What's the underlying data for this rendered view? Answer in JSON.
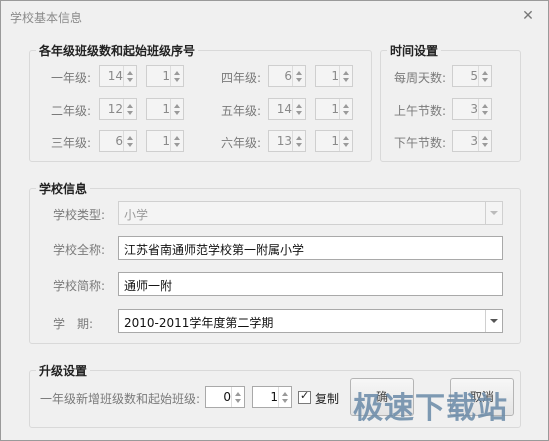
{
  "window": {
    "title": "学校基本信息"
  },
  "classes": {
    "title": "各年级班级数和起始班级序号",
    "rows": [
      {
        "label": "一年级:",
        "count": "14",
        "start": "1"
      },
      {
        "label": "二年级:",
        "count": "12",
        "start": "1"
      },
      {
        "label": "三年级:",
        "count": "6",
        "start": "1"
      },
      {
        "label": "四年级:",
        "count": "6",
        "start": "1"
      },
      {
        "label": "五年级:",
        "count": "14",
        "start": "1"
      },
      {
        "label": "六年级:",
        "count": "13",
        "start": "1"
      }
    ]
  },
  "time": {
    "title": "时间设置",
    "rows": [
      {
        "label": "每周天数:",
        "value": "5"
      },
      {
        "label": "上午节数:",
        "value": "3"
      },
      {
        "label": "下午节数:",
        "value": "3"
      }
    ]
  },
  "school": {
    "title": "学校信息",
    "type_label": "学校类型:",
    "type_value": "小学",
    "fullname_label": "学校全称:",
    "fullname_value": "江苏省南通师范学校第一附属小学",
    "shortname_label": "学校简称:",
    "shortname_value": "通师一附",
    "term_label": "学　期:",
    "term_value": "2010-2011学年度第二学期"
  },
  "upgrade": {
    "title": "升级设置",
    "label": "一年级新增班级数和起始班级:",
    "count": "0",
    "start": "1",
    "copy_label": "复制",
    "copy_checked": true
  },
  "buttons": {
    "ok_label": "确",
    "cancel_label": "取消"
  },
  "watermark": "极速下载站"
}
